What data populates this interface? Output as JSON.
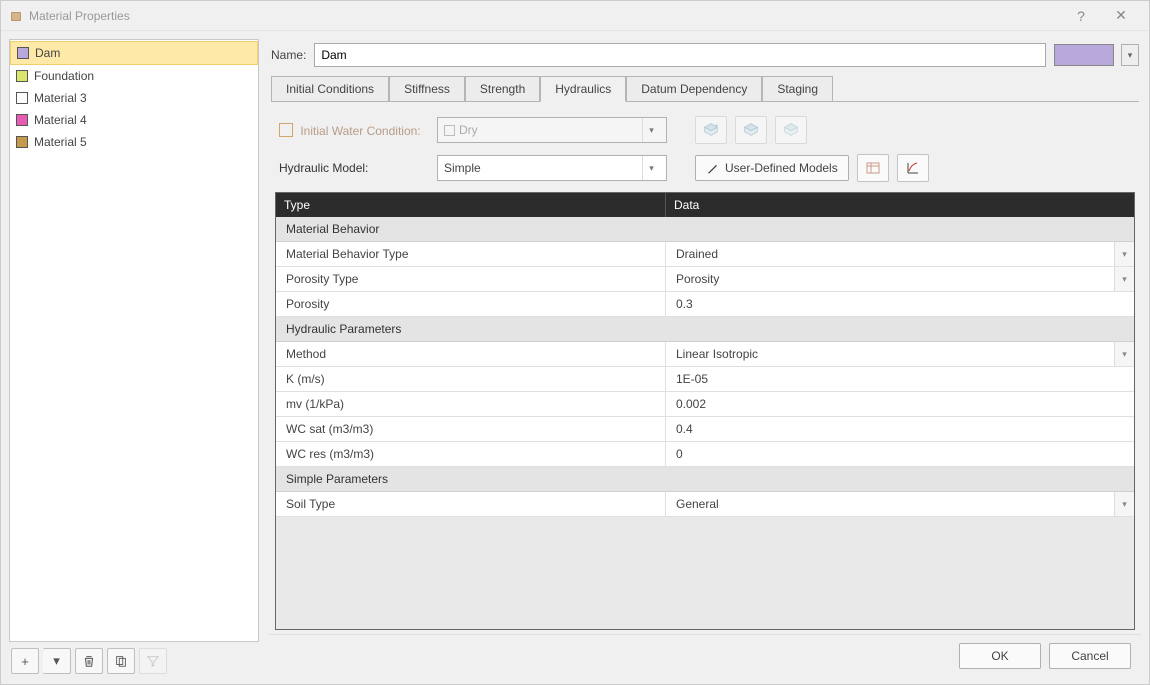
{
  "window": {
    "title": "Material Properties",
    "help_icon": "?",
    "close_icon": "✕"
  },
  "sidebar": {
    "materials": [
      {
        "name": "Dam",
        "color": "#b9a8db",
        "selected": true
      },
      {
        "name": "Foundation",
        "color": "#d8e66d",
        "selected": false
      },
      {
        "name": "Material 3",
        "color": "#ffffff",
        "selected": false
      },
      {
        "name": "Material 4",
        "color": "#e45cb3",
        "selected": false
      },
      {
        "name": "Material 5",
        "color": "#c59a4f",
        "selected": false
      }
    ],
    "toolbar": {
      "add": "+",
      "add_dd": "▾",
      "delete": "🗑",
      "copy": "⧉",
      "filter": "⌄"
    }
  },
  "nameRow": {
    "label": "Name:",
    "value": "Dam",
    "color": "#b9a8db"
  },
  "tabs": [
    {
      "id": "initial",
      "label": "Initial Conditions",
      "active": false
    },
    {
      "id": "stiffness",
      "label": "Stiffness",
      "active": false
    },
    {
      "id": "strength",
      "label": "Strength",
      "active": false
    },
    {
      "id": "hydraulics",
      "label": "Hydraulics",
      "active": true
    },
    {
      "id": "datum",
      "label": "Datum Dependency",
      "active": false
    },
    {
      "id": "staging",
      "label": "Staging",
      "active": false
    }
  ],
  "hydraulics": {
    "initialWater": {
      "label": "Initial Water Condition:",
      "checked": false,
      "value": "Dry"
    },
    "hydraulicModel": {
      "label": "Hydraulic Model:",
      "value": "Simple",
      "userDefined": "User-Defined Models"
    },
    "gridHeaders": {
      "type": "Type",
      "data": "Data"
    },
    "rows": [
      {
        "kind": "section",
        "label": "Material Behavior"
      },
      {
        "kind": "row",
        "type": "Material Behavior Type",
        "data": "Drained",
        "dropdown": true
      },
      {
        "kind": "row",
        "type": "Porosity Type",
        "data": "Porosity",
        "dropdown": true
      },
      {
        "kind": "row",
        "type": "Porosity",
        "data": "0.3",
        "dropdown": false
      },
      {
        "kind": "section",
        "label": "Hydraulic Parameters"
      },
      {
        "kind": "row",
        "type": "Method",
        "data": "Linear Isotropic",
        "dropdown": true
      },
      {
        "kind": "row",
        "type": "K (m/s)",
        "data": "1E-05",
        "dropdown": false
      },
      {
        "kind": "row",
        "type": "mv (1/kPa)",
        "data": "0.002",
        "dropdown": false
      },
      {
        "kind": "row",
        "type": "WC sat (m3/m3)",
        "data": "0.4",
        "dropdown": false
      },
      {
        "kind": "row",
        "type": "WC res (m3/m3)",
        "data": "0",
        "dropdown": false
      },
      {
        "kind": "section",
        "label": "Simple Parameters"
      },
      {
        "kind": "row",
        "type": "Soil Type",
        "data": "General",
        "dropdown": true
      }
    ]
  },
  "footer": {
    "ok": "OK",
    "cancel": "Cancel"
  }
}
